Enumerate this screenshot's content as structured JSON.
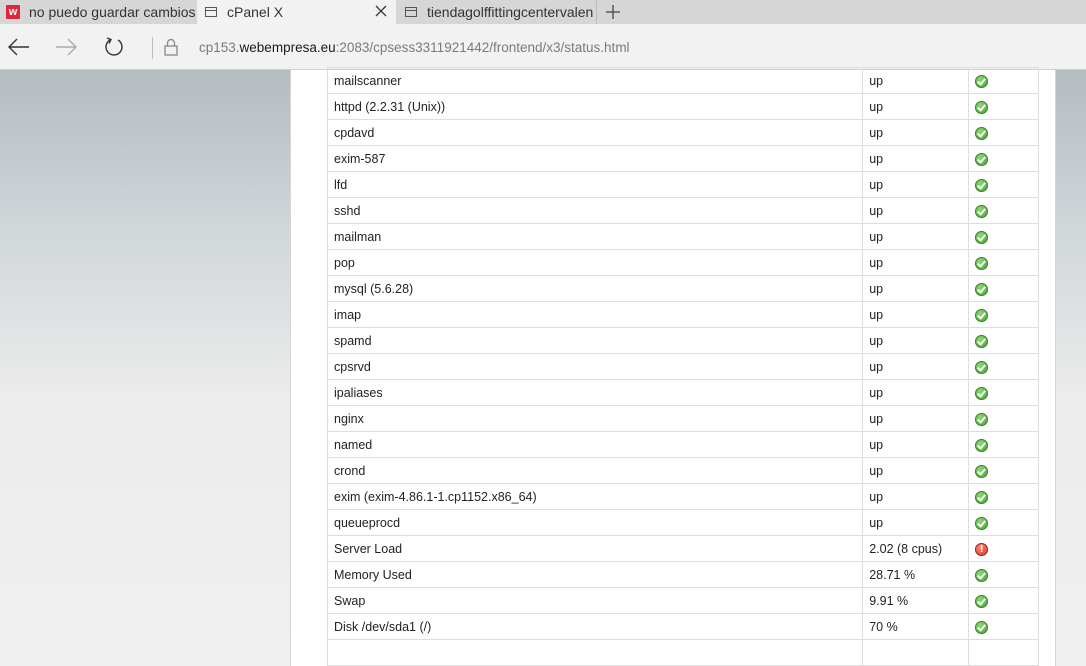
{
  "tabs": [
    {
      "title": "no puedo guardar cambios",
      "icon": "webempresa-logo-icon"
    },
    {
      "title": "cPanel X",
      "icon": "page-icon",
      "active": true
    },
    {
      "title": "tiendagolffittingcentervalen",
      "icon": "page-icon"
    }
  ],
  "logo_letter": "w",
  "address": {
    "prefix": "cp153.",
    "host": "webempresa.eu",
    "path": ":2083/cpsess3311921442/frontend/x3/status.html"
  },
  "rows": [
    {
      "name": "mailscanner",
      "status": "up",
      "icon": "ok"
    },
    {
      "name": "httpd (2.2.31 (Unix))",
      "status": "up",
      "icon": "ok"
    },
    {
      "name": "cpdavd",
      "status": "up",
      "icon": "ok"
    },
    {
      "name": "exim-587",
      "status": "up",
      "icon": "ok"
    },
    {
      "name": "lfd",
      "status": "up",
      "icon": "ok"
    },
    {
      "name": "sshd",
      "status": "up",
      "icon": "ok"
    },
    {
      "name": "mailman",
      "status": "up",
      "icon": "ok"
    },
    {
      "name": "pop",
      "status": "up",
      "icon": "ok"
    },
    {
      "name": "mysql (5.6.28)",
      "status": "up",
      "icon": "ok"
    },
    {
      "name": "imap",
      "status": "up",
      "icon": "ok"
    },
    {
      "name": "spamd",
      "status": "up",
      "icon": "ok"
    },
    {
      "name": "cpsrvd",
      "status": "up",
      "icon": "ok"
    },
    {
      "name": "ipaliases",
      "status": "up",
      "icon": "ok"
    },
    {
      "name": "nginx",
      "status": "up",
      "icon": "ok"
    },
    {
      "name": "named",
      "status": "up",
      "icon": "ok"
    },
    {
      "name": "crond",
      "status": "up",
      "icon": "ok"
    },
    {
      "name": "exim (exim-4.86.1-1.cp1152.x86_64)",
      "status": "up",
      "icon": "ok"
    },
    {
      "name": "queueprocd",
      "status": "up",
      "icon": "ok"
    },
    {
      "name": "Server Load",
      "status": "2.02 (8 cpus)",
      "icon": "warning"
    },
    {
      "name": "Memory Used",
      "status": "28.71 %",
      "icon": "ok"
    },
    {
      "name": "Swap",
      "status": "9.91 %",
      "icon": "ok"
    },
    {
      "name": "Disk /dev/sda1 (/)",
      "status": "70 %",
      "icon": "ok"
    },
    {
      "name": "",
      "status": "",
      "icon": "none"
    }
  ],
  "colors": {
    "ok": "#3f9b2c",
    "warning": "#d0311f"
  }
}
